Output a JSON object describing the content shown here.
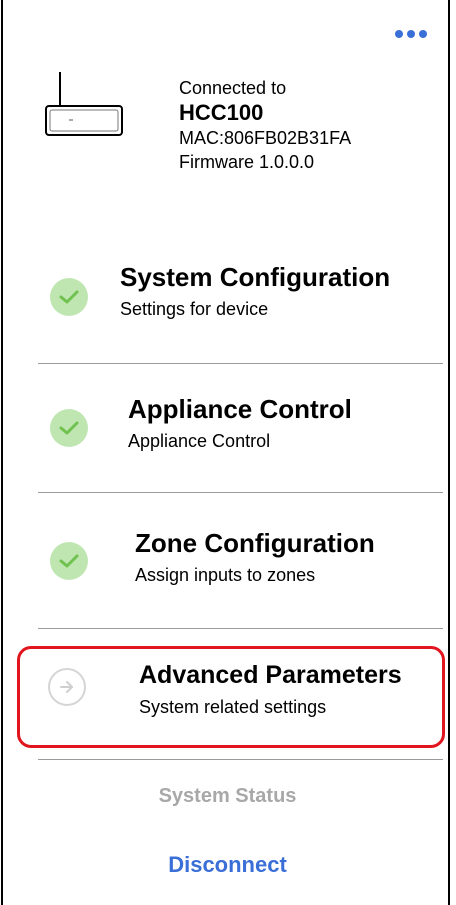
{
  "connection": {
    "connected_label": "Connected to",
    "device_name": "HCC100",
    "mac": "MAC:806FB02B31FA",
    "firmware": "Firmware 1.0.0.0"
  },
  "menu": [
    {
      "title": "System Configuration",
      "subtitle": "Settings for device",
      "status": "complete"
    },
    {
      "title": "Appliance Control",
      "subtitle": "Appliance Control",
      "status": "complete"
    },
    {
      "title": "Zone Configuration",
      "subtitle": "Assign inputs to zones",
      "status": "complete"
    },
    {
      "title": "Advanced Parameters",
      "subtitle": "System related settings",
      "status": "pending",
      "highlighted": true
    }
  ],
  "actions": {
    "status_label": "System Status",
    "disconnect_label": "Disconnect"
  },
  "colors": {
    "accent": "#3a6fd8",
    "check_bg": "#bfe6b0",
    "check_mark": "#6fc24f",
    "highlight": "#e0151d",
    "disabled": "#a8a8a8"
  }
}
